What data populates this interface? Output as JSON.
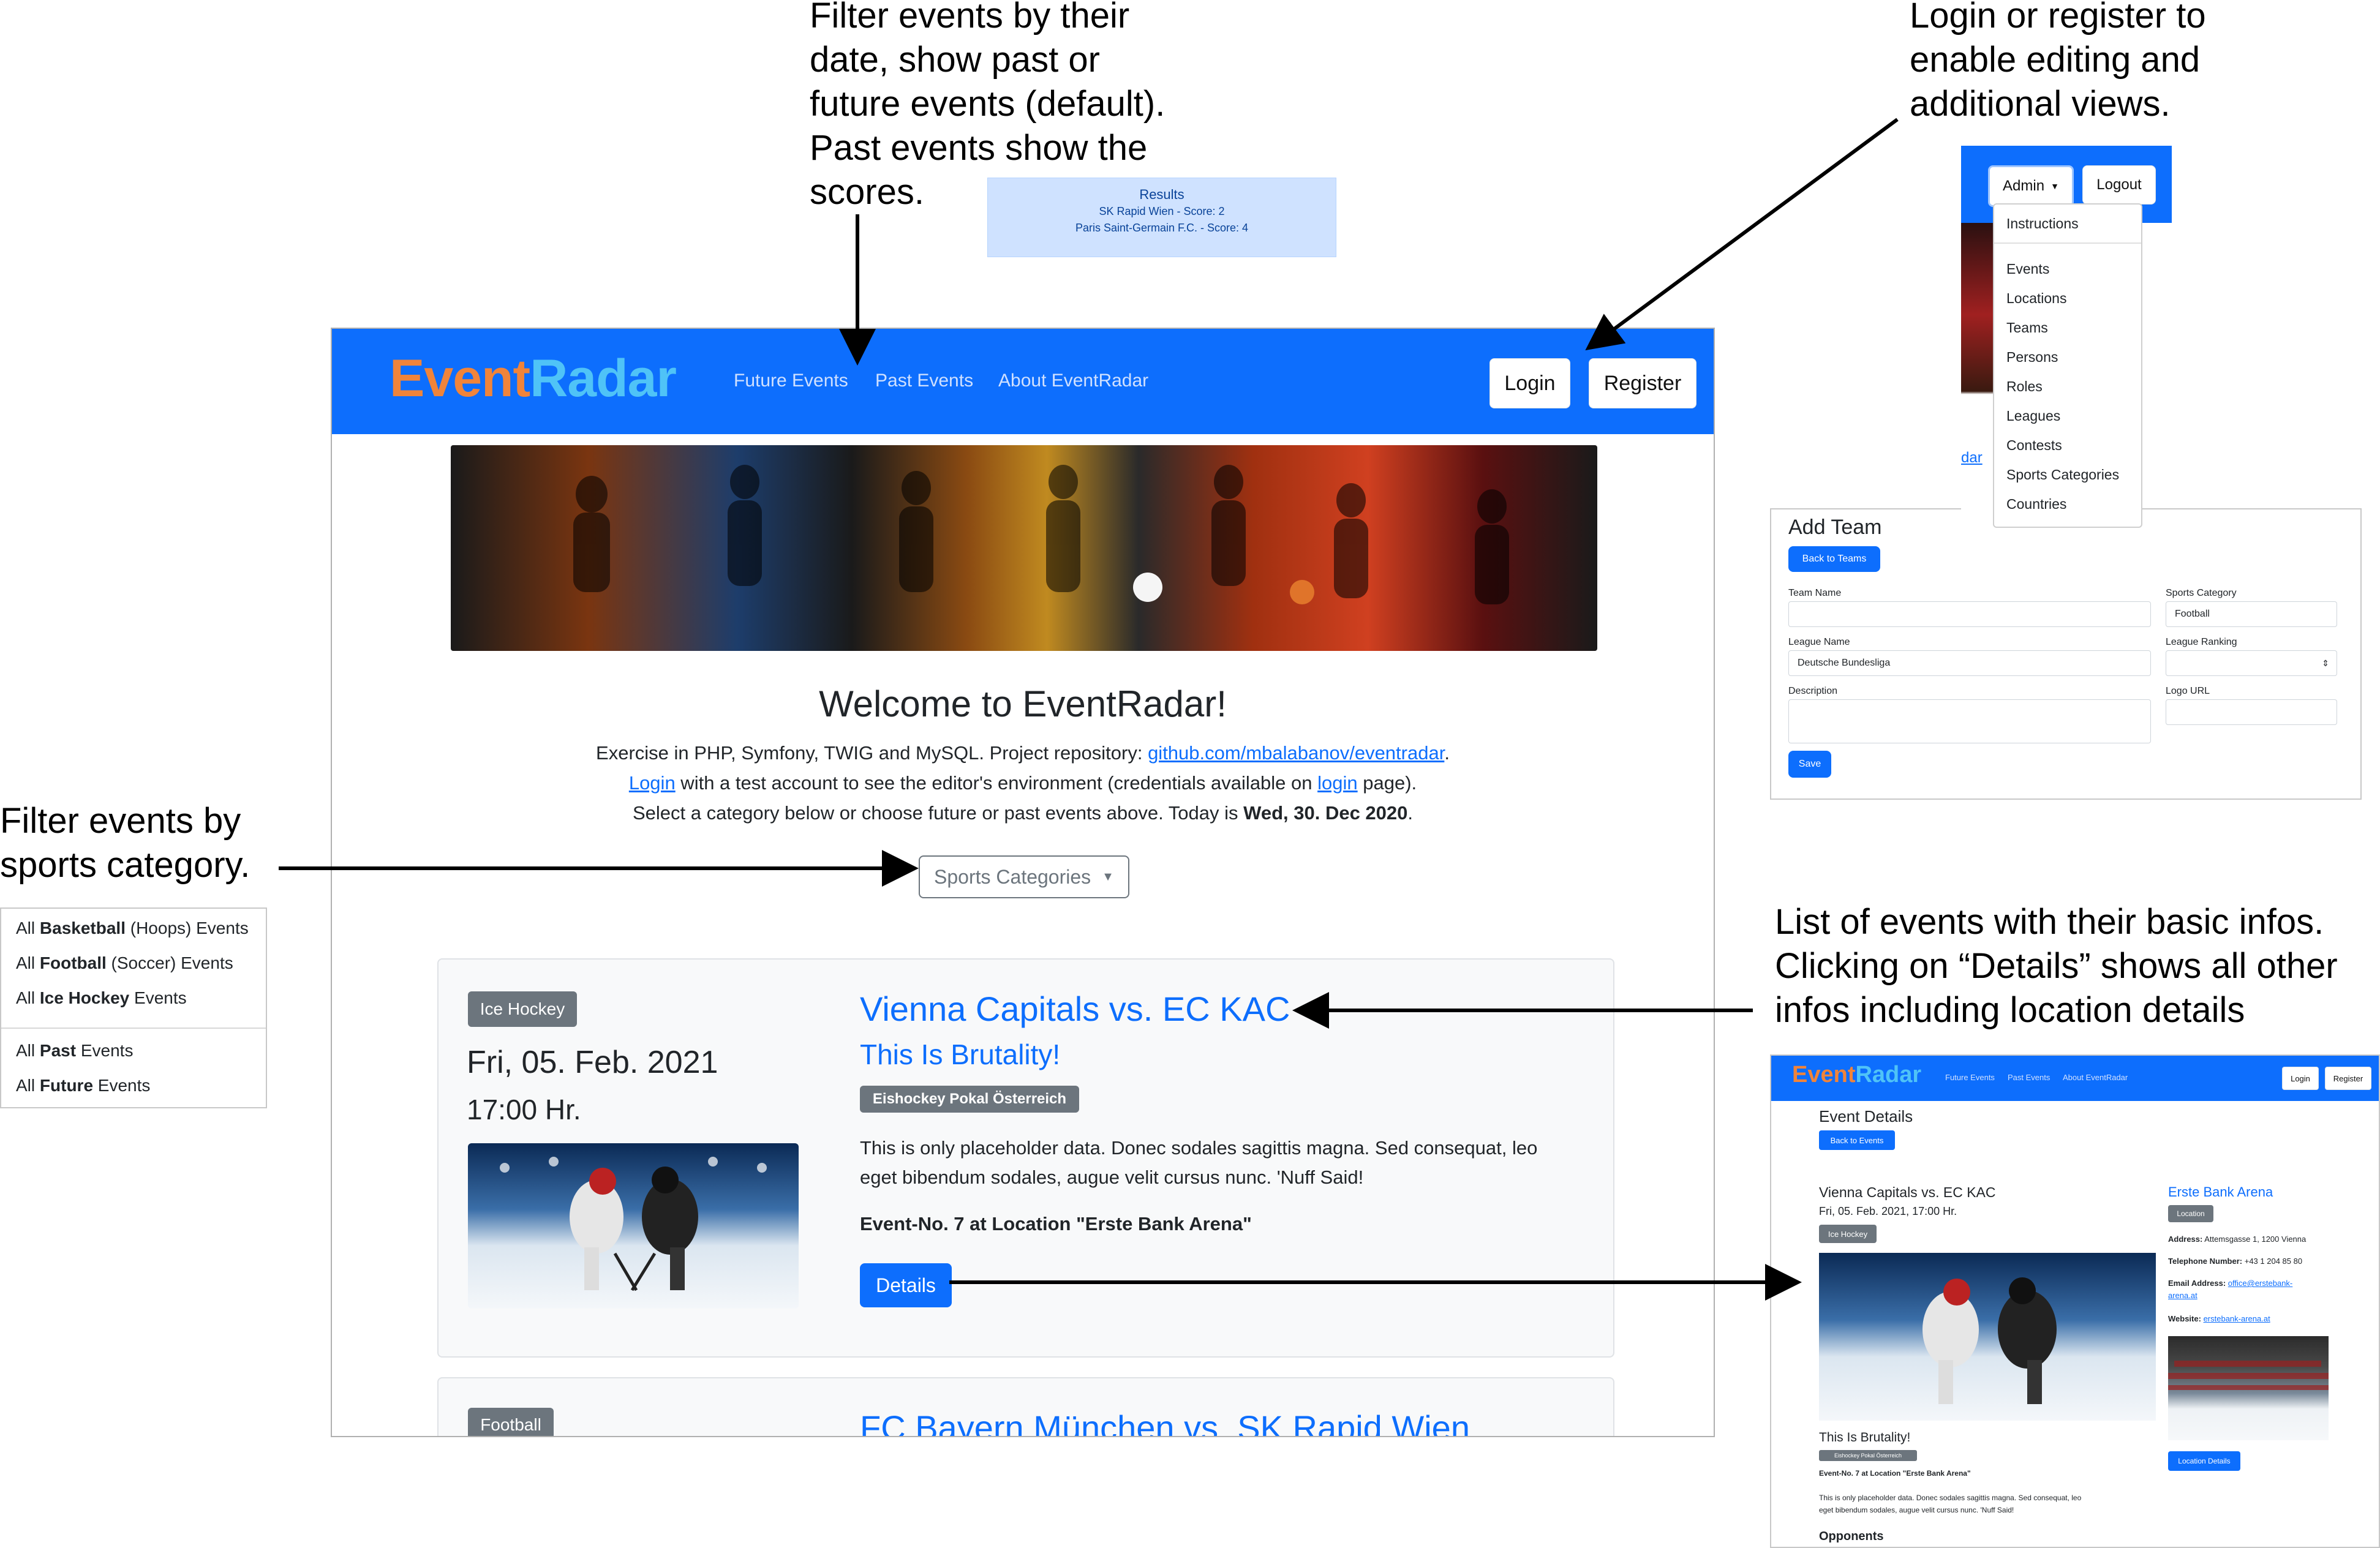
{
  "callouts": {
    "date_filter": [
      "Filter events by their",
      "date, show past or",
      "future events (default).",
      "Past events show the",
      "scores."
    ],
    "login": [
      "Login or register to",
      "enable editing and",
      "additional views."
    ],
    "category_filter": [
      "Filter events by",
      "sports category."
    ],
    "event_list": [
      "List of events with their basic infos.",
      "Clicking on “Details” shows all other",
      "infos including location details"
    ]
  },
  "results_box": {
    "title": "Results",
    "line1": "SK Rapid Wien - Score: 2",
    "line2": "Paris Saint-Germain F.C. - Score: 4"
  },
  "main": {
    "logo": {
      "part1": "Event",
      "part2": "Radar"
    },
    "nav": {
      "future": "Future Events",
      "past": "Past Events",
      "about": "About EventRadar"
    },
    "login_button": "Login",
    "register_button": "Register",
    "welcome_title": "Welcome to EventRadar!",
    "intro": {
      "line1_text": "Exercise in PHP, Symfony, TWIG and MySQL. Project repository: ",
      "repo_link": "github.com/mbalabanov/eventradar",
      "line1_end": ".",
      "login_link": "Login",
      "line2_text": " with a test account to see the editor's environment (credentials available on ",
      "login_page_link": "login",
      "line2_end": " page).",
      "line3_text": "Select a category below or choose future or past events above. Today is ",
      "today": "Wed, 30. Dec 2020",
      "line3_end": "."
    },
    "sports_dropdown": "Sports Categories",
    "event": {
      "category": "Ice Hockey",
      "date": "Fri, 05. Feb. 2021",
      "time": "17:00 Hr.",
      "title": "Vienna Capitals vs. EC KAC",
      "subtitle": "This Is Brutality!",
      "league": "Eishockey Pokal Österreich",
      "description_line1": "This is only placeholder data. Donec sodales sagittis magna. Sed consequat, leo",
      "description_line2": "eget bibendum sodales, augue velit cursus nunc. 'Nuff Said!",
      "location_line": "Event-No. 7 at Location \"Erste Bank Arena\"",
      "details_button": "Details"
    },
    "event2": {
      "category": "Football",
      "title": "FC Bayern München vs. SK Rapid Wien"
    }
  },
  "category_menu": {
    "basketball": {
      "pre": "All ",
      "bold": "Basketball",
      "post": " (Hoops) Events"
    },
    "football": {
      "pre": "All ",
      "bold": "Football",
      "post": " (Soccer) Events"
    },
    "icehockey": {
      "pre": "All ",
      "bold": "Ice Hockey",
      "post": " Events"
    },
    "past": {
      "pre": "All ",
      "bold": "Past",
      "post": " Events"
    },
    "future": {
      "pre": "All ",
      "bold": "Future",
      "post": " Events"
    }
  },
  "admin_menu": {
    "admin_button": "Admin",
    "logout_button": "Logout",
    "items": [
      "Instructions",
      "Events",
      "Locations",
      "Teams",
      "Persons",
      "Roles",
      "Leagues",
      "Contests",
      "Sports Categories",
      "Countries"
    ],
    "behind_link": "dar"
  },
  "add_team": {
    "title": "Add Team",
    "back_button": "Back to Teams",
    "team_name_label": "Team Name",
    "sports_category_label": "Sports Category",
    "sports_category_value": "Football",
    "league_name_label": "League Name",
    "league_name_value": "Deutsche Bundesliga",
    "league_ranking_label": "League Ranking",
    "description_label": "Description",
    "logo_url_label": "Logo URL",
    "save_button": "Save"
  },
  "details_page": {
    "logo": {
      "part1": "Event",
      "part2": "Radar"
    },
    "nav": {
      "future": "Future Events",
      "past": "Past Events",
      "about": "About EventRadar"
    },
    "login_button": "Login",
    "register_button": "Register",
    "title": "Event Details",
    "back_button": "Back to Events",
    "event_title": "Vienna Capitals vs. EC KAC",
    "datetime": "Fri, 05. Feb. 2021, 17:00 Hr.",
    "category": "Ice Hockey",
    "subtitle": "This Is Brutality!",
    "league": "Eishockey Pokal Österreich",
    "location_line": "Event-No. 7 at Location \"Erste Bank Arena\"",
    "description_line1": "This is only placeholder data. Donec sodales sagittis magna. Sed consequat, leo",
    "description_line2": "eget bibendum sodales, augue velit cursus nunc. 'Nuff Said!",
    "opponents": "Opponents",
    "location_name": "Erste Bank Arena",
    "location_badge": "Location",
    "address_label": "Address:",
    "address": "Attemsgasse 1, 1200 Vienna",
    "phone_label": "Telephone Number:",
    "phone": "+43 1 204 85 80",
    "email_label": "Email Address:",
    "email_1": "office@erstebank-",
    "email_2": "arena.at",
    "website_label": "Website:",
    "website": "erstebank-arena.at",
    "location_details_button": "Location Details"
  },
  "colors": {
    "brand_blue": "#0d6efd",
    "badge_grey": "#6c757d",
    "logo_orange": "#f0843a",
    "logo_cyan": "#4fc3f7"
  }
}
